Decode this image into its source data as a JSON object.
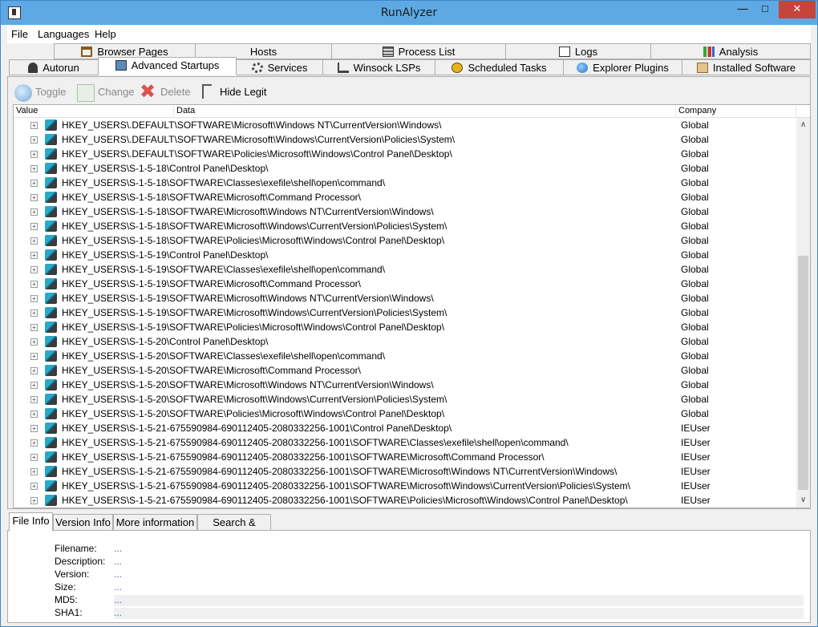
{
  "window": {
    "title": "RunAlyzer"
  },
  "menu": [
    "File",
    "Languages",
    "Help"
  ],
  "tabs_row1": [
    {
      "label": "Browser Pages",
      "icon": "house-icon"
    },
    {
      "label": "Hosts",
      "icon": ""
    },
    {
      "label": "Process List",
      "icon": "server-icon"
    },
    {
      "label": "Logs",
      "icon": "document-icon"
    },
    {
      "label": "Analysis",
      "icon": "chart-icon"
    }
  ],
  "tabs_row2": [
    {
      "label": "Autorun",
      "icon": "runner-icon"
    },
    {
      "label": "Advanced Startups",
      "icon": "monitor-icon",
      "active": true
    },
    {
      "label": "Services",
      "icon": "gear-icon"
    },
    {
      "label": "Winsock LSPs",
      "icon": "network-icon"
    },
    {
      "label": "Scheduled Tasks",
      "icon": "clock-icon"
    },
    {
      "label": "Explorer Plugins",
      "icon": "globe-icon"
    },
    {
      "label": "Installed Software",
      "icon": "box-icon"
    }
  ],
  "toolbar": {
    "toggle": "Toggle",
    "change": "Change",
    "delete": "Delete",
    "hide_legit": "Hide Legit"
  },
  "columns": {
    "value": "Value",
    "data": "Data",
    "company": "Company"
  },
  "rows": [
    {
      "data": "HKEY_USERS\\.DEFAULT\\SOFTWARE\\Microsoft\\Windows NT\\CurrentVersion\\Windows\\",
      "company": "Global"
    },
    {
      "data": "HKEY_USERS\\.DEFAULT\\SOFTWARE\\Microsoft\\Windows\\CurrentVersion\\Policies\\System\\",
      "company": "Global"
    },
    {
      "data": "HKEY_USERS\\.DEFAULT\\SOFTWARE\\Policies\\Microsoft\\Windows\\Control Panel\\Desktop\\",
      "company": "Global"
    },
    {
      "data": "HKEY_USERS\\S-1-5-18\\Control Panel\\Desktop\\",
      "company": "Global"
    },
    {
      "data": "HKEY_USERS\\S-1-5-18\\SOFTWARE\\Classes\\exefile\\shell\\open\\command\\",
      "company": "Global"
    },
    {
      "data": "HKEY_USERS\\S-1-5-18\\SOFTWARE\\Microsoft\\Command Processor\\",
      "company": "Global"
    },
    {
      "data": "HKEY_USERS\\S-1-5-18\\SOFTWARE\\Microsoft\\Windows NT\\CurrentVersion\\Windows\\",
      "company": "Global"
    },
    {
      "data": "HKEY_USERS\\S-1-5-18\\SOFTWARE\\Microsoft\\Windows\\CurrentVersion\\Policies\\System\\",
      "company": "Global"
    },
    {
      "data": "HKEY_USERS\\S-1-5-18\\SOFTWARE\\Policies\\Microsoft\\Windows\\Control Panel\\Desktop\\",
      "company": "Global"
    },
    {
      "data": "HKEY_USERS\\S-1-5-19\\Control Panel\\Desktop\\",
      "company": "Global"
    },
    {
      "data": "HKEY_USERS\\S-1-5-19\\SOFTWARE\\Classes\\exefile\\shell\\open\\command\\",
      "company": "Global"
    },
    {
      "data": "HKEY_USERS\\S-1-5-19\\SOFTWARE\\Microsoft\\Command Processor\\",
      "company": "Global"
    },
    {
      "data": "HKEY_USERS\\S-1-5-19\\SOFTWARE\\Microsoft\\Windows NT\\CurrentVersion\\Windows\\",
      "company": "Global"
    },
    {
      "data": "HKEY_USERS\\S-1-5-19\\SOFTWARE\\Microsoft\\Windows\\CurrentVersion\\Policies\\System\\",
      "company": "Global"
    },
    {
      "data": "HKEY_USERS\\S-1-5-19\\SOFTWARE\\Policies\\Microsoft\\Windows\\Control Panel\\Desktop\\",
      "company": "Global"
    },
    {
      "data": "HKEY_USERS\\S-1-5-20\\Control Panel\\Desktop\\",
      "company": "Global"
    },
    {
      "data": "HKEY_USERS\\S-1-5-20\\SOFTWARE\\Classes\\exefile\\shell\\open\\command\\",
      "company": "Global"
    },
    {
      "data": "HKEY_USERS\\S-1-5-20\\SOFTWARE\\Microsoft\\Command Processor\\",
      "company": "Global"
    },
    {
      "data": "HKEY_USERS\\S-1-5-20\\SOFTWARE\\Microsoft\\Windows NT\\CurrentVersion\\Windows\\",
      "company": "Global"
    },
    {
      "data": "HKEY_USERS\\S-1-5-20\\SOFTWARE\\Microsoft\\Windows\\CurrentVersion\\Policies\\System\\",
      "company": "Global"
    },
    {
      "data": "HKEY_USERS\\S-1-5-20\\SOFTWARE\\Policies\\Microsoft\\Windows\\Control Panel\\Desktop\\",
      "company": "Global"
    },
    {
      "data": "HKEY_USERS\\S-1-5-21-675590984-690112405-2080332256-1001\\Control Panel\\Desktop\\",
      "company": "IEUser"
    },
    {
      "data": "HKEY_USERS\\S-1-5-21-675590984-690112405-2080332256-1001\\SOFTWARE\\Classes\\exefile\\shell\\open\\command\\",
      "company": "IEUser"
    },
    {
      "data": "HKEY_USERS\\S-1-5-21-675590984-690112405-2080332256-1001\\SOFTWARE\\Microsoft\\Command Processor\\",
      "company": "IEUser"
    },
    {
      "data": "HKEY_USERS\\S-1-5-21-675590984-690112405-2080332256-1001\\SOFTWARE\\Microsoft\\Windows NT\\CurrentVersion\\Windows\\",
      "company": "IEUser"
    },
    {
      "data": "HKEY_USERS\\S-1-5-21-675590984-690112405-2080332256-1001\\SOFTWARE\\Microsoft\\Windows\\CurrentVersion\\Policies\\System\\",
      "company": "IEUser"
    },
    {
      "data": "HKEY_USERS\\S-1-5-21-675590984-690112405-2080332256-1001\\SOFTWARE\\Policies\\Microsoft\\Windows\\Control Panel\\Desktop\\",
      "company": "IEUser"
    }
  ],
  "bottom_tabs": [
    "File Info",
    "Version Info",
    "More information",
    "Search & Filters"
  ],
  "file_info": [
    {
      "label": "Filename:",
      "value": "..."
    },
    {
      "label": "Description:",
      "value": "..."
    },
    {
      "label": "Version:",
      "value": "..."
    },
    {
      "label": "Size:",
      "value": "..."
    },
    {
      "label": "MD5:",
      "value": "..."
    },
    {
      "label": "SHA1:",
      "value": "..."
    }
  ],
  "colors": {
    "titlebar": "#5ea9e3",
    "close": "#c7443a",
    "link": "#3a6ec0"
  }
}
